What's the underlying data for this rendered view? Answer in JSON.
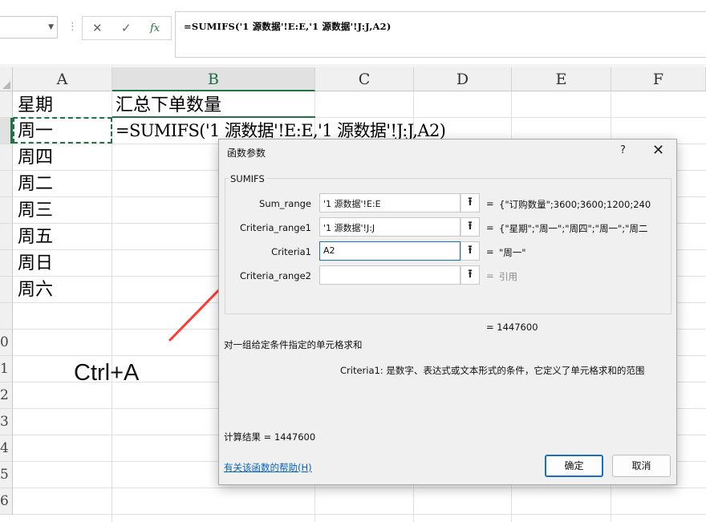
{
  "formula_bar": {
    "formula": "=SUMIFS('1 源数据'!E:E,'1 源数据'!J:J,A2)",
    "cancel_icon": "close-icon",
    "enter_icon": "check-icon",
    "fx_label": "fx"
  },
  "columns": [
    "A",
    "B",
    "C",
    "D",
    "E",
    "F"
  ],
  "rows": [
    "",
    "",
    "",
    "",
    "",
    "",
    "",
    "",
    "",
    "0",
    "1",
    "2",
    "3",
    "4",
    "5",
    "6"
  ],
  "cells": {
    "a1": "星期",
    "b1": "汇总下单数量",
    "a2": "周一",
    "b2": "=SUMIFS('1 源数据'!E:E,'1 源数据'!J:J,A2)",
    "a3": "周四",
    "a4": "周二",
    "a5": "周三",
    "a6": "周五",
    "a7": "周日",
    "a8": "周六"
  },
  "annotation": {
    "text": "Ctrl+A",
    "arrow_color": "#ff3b30"
  },
  "dialog": {
    "title": "函数参数",
    "help": "?",
    "close": "✕",
    "function_name": "SUMIFS",
    "args": [
      {
        "label": "Sum_range",
        "value": "'1 源数据'!E:E",
        "result": "{\"订购数量\";3600;3600;1200;240"
      },
      {
        "label": "Criteria_range1",
        "value": "'1 源数据'!J:J",
        "result": "{\"星期\";\"周一\";\"周四\";\"周一\";\"周二"
      },
      {
        "label": "Criteria1",
        "value": "A2",
        "result": "\"周一\""
      },
      {
        "label": "Criteria_range2",
        "value": "",
        "result": "引用"
      }
    ],
    "eq": "=",
    "result_line": "=   1447600",
    "description": "对一组给定条件指定的单元格求和",
    "criteria_description": "Criteria1:  是数字、表达式或文本形式的条件，它定义了单元格求和的范围",
    "calc_result": "计算结果 =   1447600",
    "help_link": "有关该函数的帮助(H)",
    "ok": "确定",
    "cancel": "取消"
  },
  "colors": {
    "accent": "#217346",
    "ok_border": "#1b6ec2",
    "link": "#0563c1"
  }
}
